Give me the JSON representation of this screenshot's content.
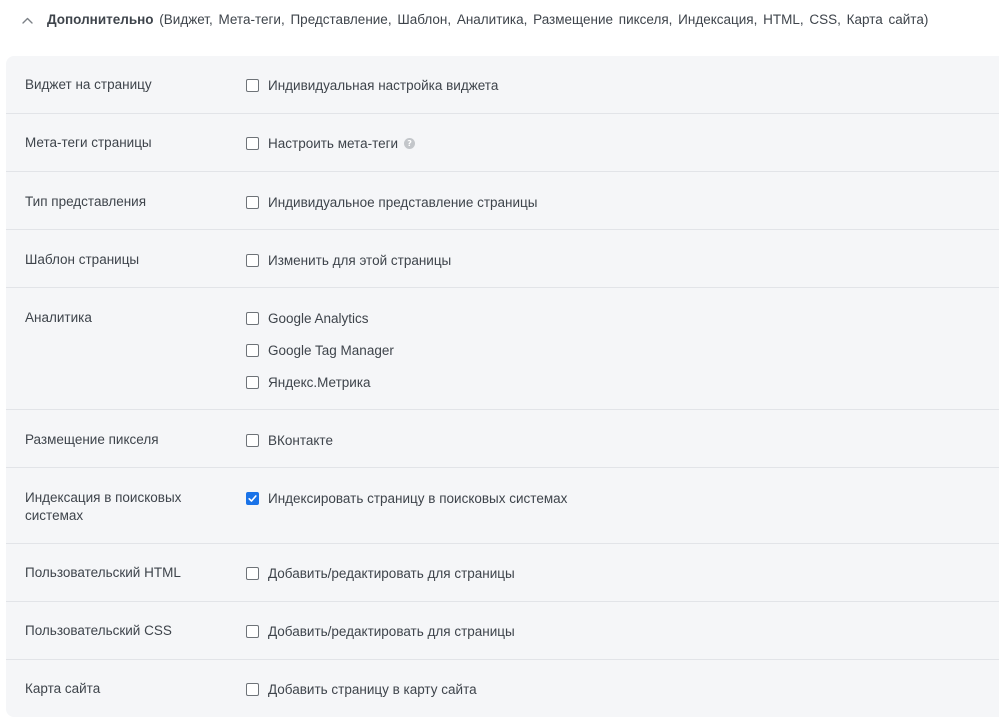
{
  "header": {
    "title": "Дополнительно",
    "list": " (Виджет, Мета-теги, Представление, Шаблон, Аналитика, Размещение пикселя, Индексация, HTML, CSS, Карта сайта)"
  },
  "rows": [
    {
      "label": "Виджет на страницу",
      "options": [
        {
          "label": "Индивидуальная настройка виджета",
          "checked": false
        }
      ]
    },
    {
      "label": "Мета-теги страницы",
      "options": [
        {
          "label": "Настроить мета-теги",
          "checked": false,
          "help": "?"
        }
      ]
    },
    {
      "label": "Тип представления",
      "options": [
        {
          "label": "Индивидуальное представление страницы",
          "checked": false
        }
      ]
    },
    {
      "label": "Шаблон страницы",
      "options": [
        {
          "label": "Изменить для этой страницы",
          "checked": false
        }
      ]
    },
    {
      "label": "Аналитика",
      "options": [
        {
          "label": "Google Analytics",
          "checked": false
        },
        {
          "label": "Google Tag Manager",
          "checked": false
        },
        {
          "label": "Яндекс.Метрика",
          "checked": false
        }
      ]
    },
    {
      "label": "Размещение пикселя",
      "options": [
        {
          "label": "ВКонтакте",
          "checked": false
        }
      ]
    },
    {
      "label": "Индексация в поисковых системах",
      "options": [
        {
          "label": "Индексировать страницу в поисковых системах",
          "checked": true
        }
      ]
    },
    {
      "label": "Пользовательский HTML",
      "options": [
        {
          "label": "Добавить/редактировать для страницы",
          "checked": false
        }
      ]
    },
    {
      "label": "Пользовательский CSS",
      "options": [
        {
          "label": "Добавить/редактировать для страницы",
          "checked": false
        }
      ]
    },
    {
      "label": "Карта сайта",
      "options": [
        {
          "label": "Добавить страницу в карту сайта",
          "checked": false
        }
      ]
    }
  ],
  "colors": {
    "panel_bg": "#f5f6f8",
    "divider": "#e2e4e8",
    "checkbox_checked": "#1a73e8",
    "text": "#3e444b"
  },
  "icons": {
    "collapse": "chevron-up-icon",
    "help": "question-circle-icon"
  }
}
